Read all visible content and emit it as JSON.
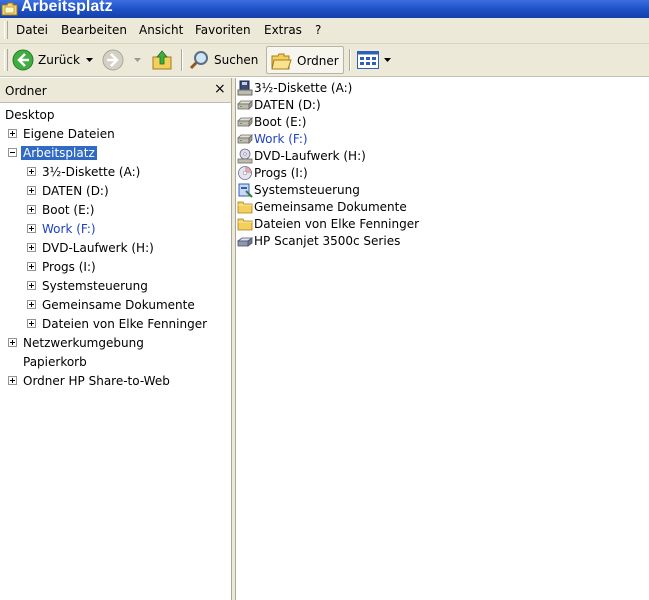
{
  "window": {
    "title": "Arbeitsplatz"
  },
  "menu": [
    "Datei",
    "Bearbeiten",
    "Ansicht",
    "Favoriten",
    "Extras",
    "?"
  ],
  "toolbar": {
    "back_label": "Zurück",
    "search_label": "Suchen",
    "folders_label": "Ordner"
  },
  "folders_pane": {
    "title": "Ordner",
    "close_glyph": "×",
    "tree": [
      {
        "label": "Desktop",
        "expander": "none"
      },
      {
        "label": "Eigene Dateien",
        "expander": "plus"
      },
      {
        "label": "Arbeitsplatz",
        "expander": "minus",
        "selected": true
      },
      {
        "label": "3½-Diskette (A:)",
        "expander": "plus"
      },
      {
        "label": "DATEN (D:)",
        "expander": "plus"
      },
      {
        "label": "Boot (E:)",
        "expander": "plus"
      },
      {
        "label": "Work (F:)",
        "expander": "plus",
        "highlight": true
      },
      {
        "label": "DVD-Laufwerk (H:)",
        "expander": "plus"
      },
      {
        "label": "Progs (I:)",
        "expander": "plus"
      },
      {
        "label": "Systemsteuerung",
        "expander": "plus"
      },
      {
        "label": "Gemeinsame Dokumente",
        "expander": "plus"
      },
      {
        "label": "Dateien von Elke Fenninger",
        "expander": "plus"
      },
      {
        "label": "Netzwerkumgebung",
        "expander": "plus"
      },
      {
        "label": "Papierkorb",
        "expander": "none"
      },
      {
        "label": "Ordner HP Share-to-Web",
        "expander": "plus"
      }
    ]
  },
  "content": {
    "items": [
      {
        "label": "3½-Diskette (A:)",
        "icon": "floppy-drive-icon"
      },
      {
        "label": "DATEN (D:)",
        "icon": "hard-drive-icon"
      },
      {
        "label": "Boot (E:)",
        "icon": "hard-drive-icon"
      },
      {
        "label": "Work (F:)",
        "icon": "hard-drive-icon",
        "highlight": true
      },
      {
        "label": "DVD-Laufwerk (H:)",
        "icon": "dvd-drive-icon"
      },
      {
        "label": "Progs (I:)",
        "icon": "cd-drive-icon"
      },
      {
        "label": "Systemsteuerung",
        "icon": "control-panel-icon"
      },
      {
        "label": "Gemeinsame Dokumente",
        "icon": "folder-icon"
      },
      {
        "label": "Dateien von Elke Fenninger",
        "icon": "folder-icon"
      },
      {
        "label": "HP Scanjet 3500c Series",
        "icon": "scanner-icon"
      }
    ]
  },
  "colors": {
    "title_bar": "#1d4fc4",
    "selection": "#316ac5",
    "highlight_text": "#2040c8",
    "chrome": "#ece9d8"
  }
}
